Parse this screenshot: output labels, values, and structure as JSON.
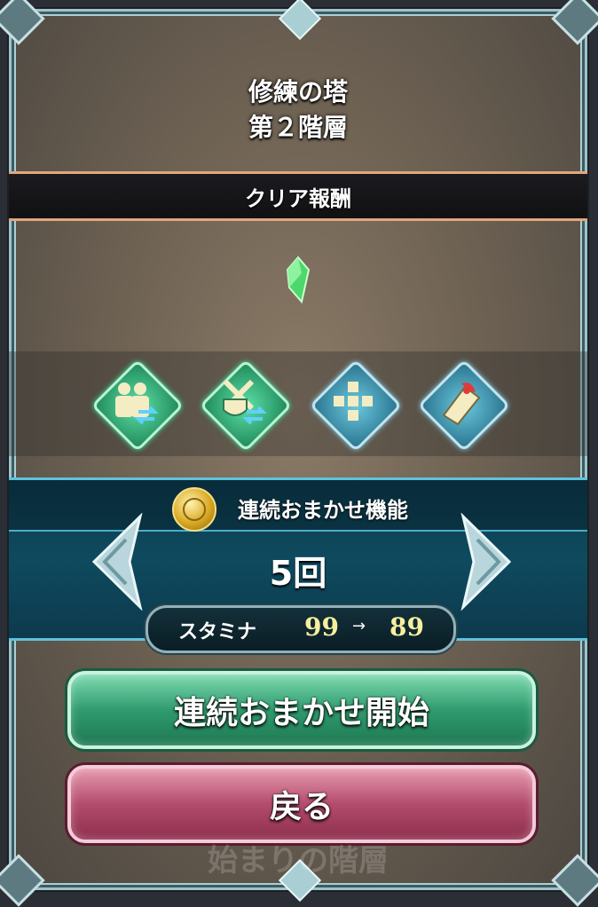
{
  "header": {
    "title_line1": "修練の塔",
    "title_line2": "第２階層"
  },
  "reward": {
    "label": "クリア報酬",
    "item_icon": "green-gem-icon"
  },
  "skills": [
    {
      "name": "ally-swap-icon",
      "tone": "green"
    },
    {
      "name": "weapon-swap-icon",
      "tone": "green"
    },
    {
      "name": "cross-formation-icon",
      "tone": "blue"
    },
    {
      "name": "scroll-icon",
      "tone": "blue"
    }
  ],
  "auto": {
    "label": "連続おまかせ機能",
    "count": "5回"
  },
  "stamina": {
    "label": "スタミナ",
    "from": "99",
    "arrow": "→",
    "to": "89"
  },
  "buttons": {
    "start": "連続おまかせ開始",
    "back": "戻る"
  },
  "background": {
    "faded_text": "始まりの階層"
  },
  "colors": {
    "start_button": "#2f9b6e",
    "back_button": "#b34c6d",
    "panel": "#0e4a5e",
    "stamina_value": "#f7ef9e"
  }
}
